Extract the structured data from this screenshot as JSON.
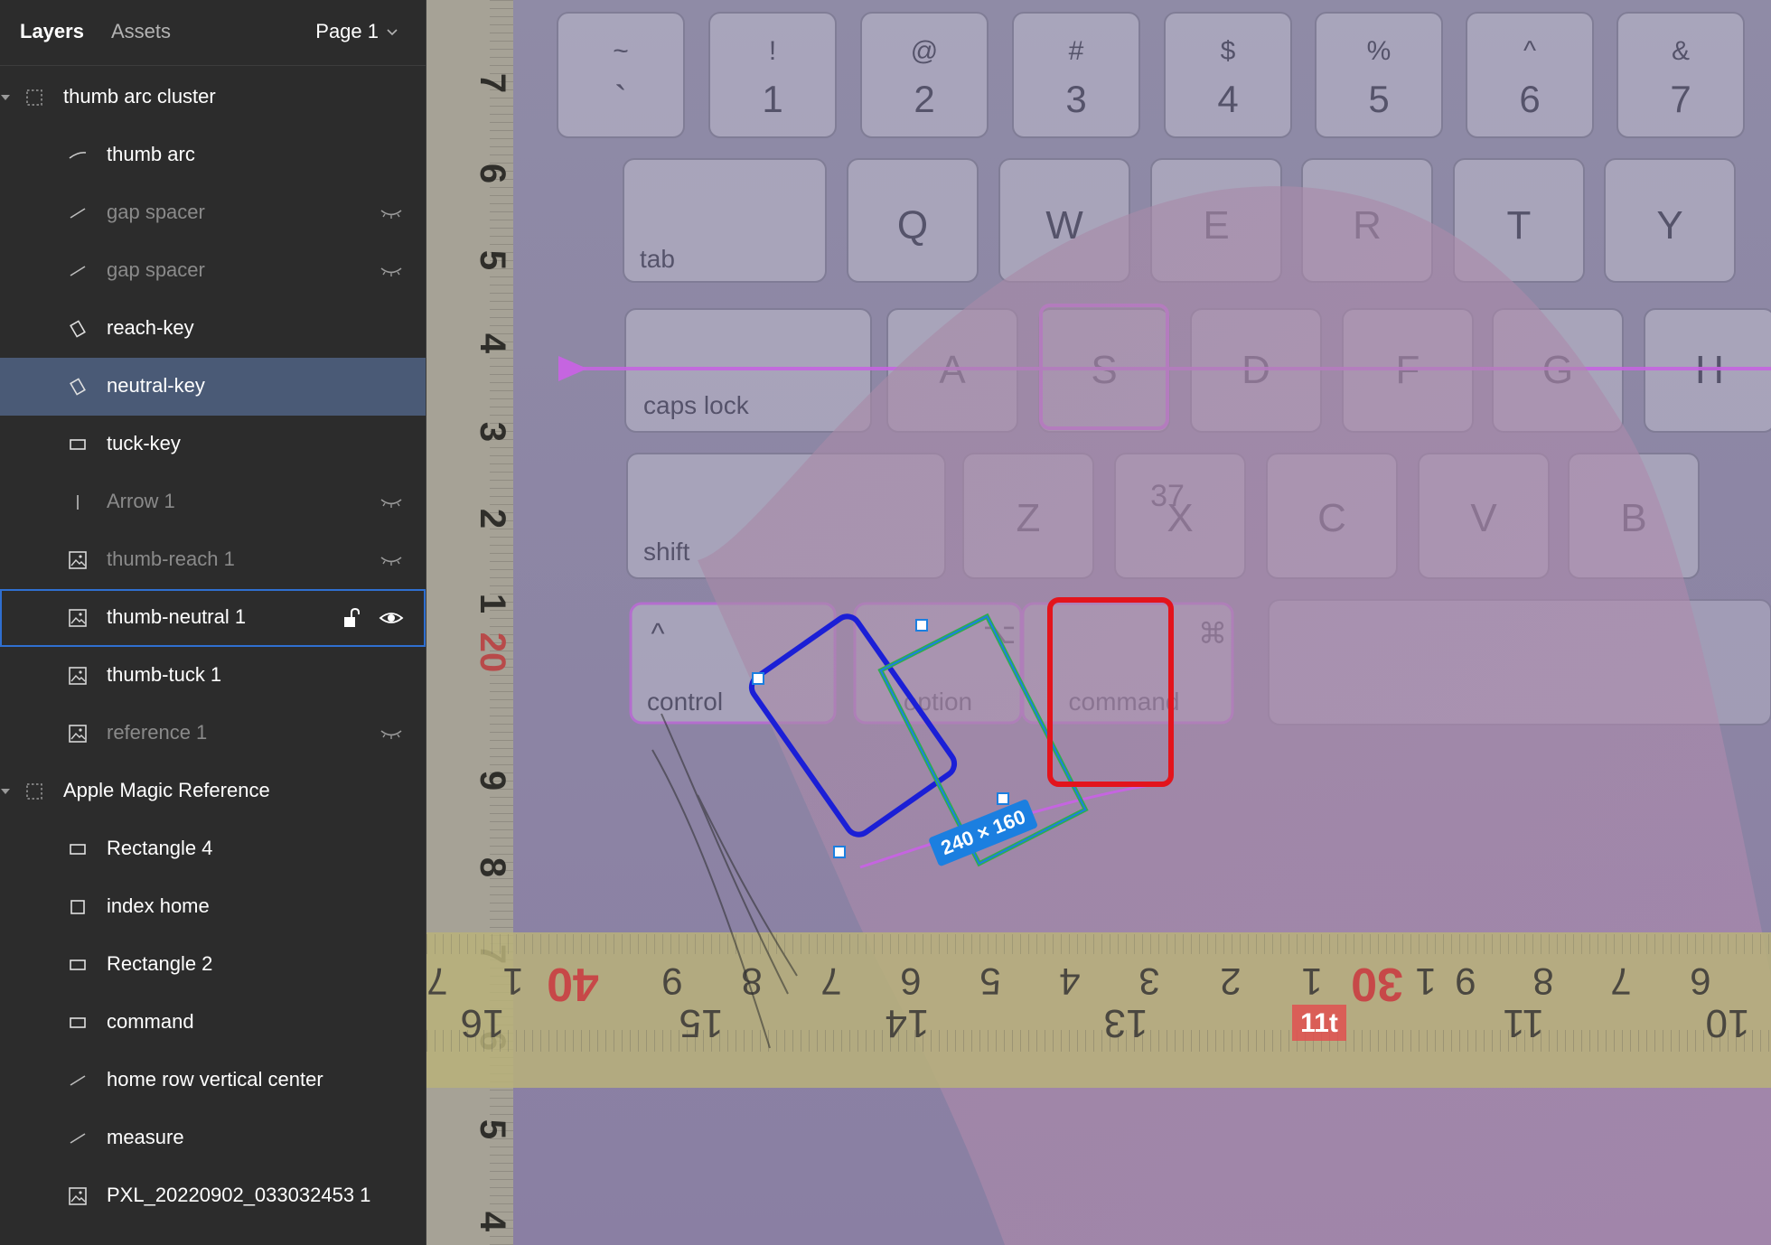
{
  "sidebar": {
    "tabs": {
      "layers": "Layers",
      "assets": "Assets"
    },
    "page": "Page 1",
    "layers": [
      {
        "name": "thumb arc cluster",
        "icon": "frame-icon",
        "hidden": false
      },
      {
        "name": "thumb arc",
        "icon": "vector-icon",
        "hidden": false
      },
      {
        "name": "gap spacer",
        "icon": "line-icon",
        "hidden": true
      },
      {
        "name": "gap spacer",
        "icon": "line-icon",
        "hidden": true
      },
      {
        "name": "reach-key",
        "icon": "rotated-rectangle-icon",
        "hidden": false
      },
      {
        "name": "neutral-key",
        "icon": "rotated-rectangle-icon",
        "hidden": false,
        "selected": true
      },
      {
        "name": "tuck-key",
        "icon": "rectangle-icon",
        "hidden": false
      },
      {
        "name": "Arrow 1",
        "icon": "arrow-icon",
        "hidden": true
      },
      {
        "name": "thumb-reach 1",
        "icon": "image-icon",
        "hidden": true
      },
      {
        "name": "thumb-neutral 1",
        "icon": "image-icon",
        "hidden": false,
        "hovered": true
      },
      {
        "name": "thumb-tuck 1",
        "icon": "image-icon",
        "hidden": false
      },
      {
        "name": "reference 1",
        "icon": "image-icon",
        "hidden": true
      },
      {
        "name": "Apple Magic Reference",
        "icon": "frame-icon",
        "hidden": false
      },
      {
        "name": "Rectangle 4",
        "icon": "rectangle-icon",
        "hidden": false
      },
      {
        "name": "index home",
        "icon": "square-icon",
        "hidden": false
      },
      {
        "name": "Rectangle 2",
        "icon": "rectangle-icon",
        "hidden": false
      },
      {
        "name": "command",
        "icon": "rectangle-icon",
        "hidden": false
      },
      {
        "name": "home row vertical center",
        "icon": "line-icon",
        "hidden": false
      },
      {
        "name": "measure",
        "icon": "line-icon",
        "hidden": false
      },
      {
        "name": "PXL_20220902_033032453 1",
        "icon": "image-icon",
        "hidden": false
      }
    ]
  },
  "canvas": {
    "selection_size": "240 × 160",
    "keyboard": {
      "number_row": [
        {
          "top": "~",
          "bottom": "`"
        },
        {
          "top": "!",
          "bottom": "1"
        },
        {
          "top": "@",
          "bottom": "2"
        },
        {
          "top": "#",
          "bottom": "3"
        },
        {
          "top": "$",
          "bottom": "4"
        },
        {
          "top": "%",
          "bottom": "5"
        },
        {
          "top": "^",
          "bottom": "6"
        },
        {
          "top": "&",
          "bottom": "7"
        }
      ],
      "qwerty_row": [
        "tab",
        "Q",
        "W",
        "E",
        "R",
        "T",
        "Y"
      ],
      "home_row": [
        "caps lock",
        "A",
        "S",
        "D",
        "F",
        "G",
        "H"
      ],
      "shift_row": [
        "shift",
        "Z",
        "X",
        "C",
        "V",
        "B"
      ],
      "bottom_row": [
        {
          "glyph": "^",
          "label": "control"
        },
        {
          "glyph": "⌥",
          "label": "option"
        },
        {
          "glyph": "⌘",
          "label": "command"
        }
      ],
      "annotation": "37"
    },
    "left_ruler": [
      "7",
      "6",
      "5",
      "4",
      "3",
      "2",
      "1",
      "20",
      "9",
      "8",
      "7",
      "6",
      "5",
      "4"
    ],
    "bottom_ruler_top": [
      "7",
      "1",
      "40",
      "9",
      "8",
      "7",
      "6",
      "5",
      "4",
      "3",
      "2",
      "1",
      "30",
      "1",
      "9",
      "8",
      "7",
      "6"
    ],
    "bottom_ruler_bottom": [
      "16",
      "15",
      "14",
      "13",
      "11",
      "10"
    ],
    "bottom_ruler_badge": "11t",
    "colors": {
      "neutral_key": "#2fae4a",
      "reach_key": "#1b1fd6",
      "tuck_key": "#e3141c",
      "magenta_guide": "#c565e0",
      "selection": "#1b7fe0"
    }
  }
}
